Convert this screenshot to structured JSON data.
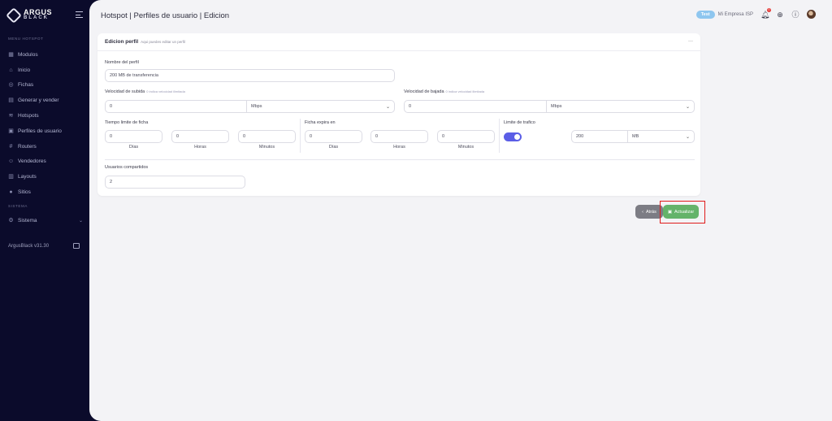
{
  "sidebar": {
    "logo_top": "ARGUS",
    "logo_bottom": "BLACK",
    "section_hotspot": "MENU HOTSPOT",
    "items": [
      {
        "label": "Modulos",
        "icon": "grid-icon"
      },
      {
        "label": "Inicio",
        "icon": "home-icon"
      },
      {
        "label": "Fichas",
        "icon": "ticket-icon"
      },
      {
        "label": "Generar y vender",
        "icon": "apps-icon"
      },
      {
        "label": "Hotspots",
        "icon": "wifi-icon"
      },
      {
        "label": "Perfiles de usuario",
        "icon": "profile-icon"
      },
      {
        "label": "Routers",
        "icon": "router-icon"
      },
      {
        "label": "Vendedores",
        "icon": "users-icon"
      },
      {
        "label": "Layouts",
        "icon": "layout-icon"
      },
      {
        "label": "Sitios",
        "icon": "location-icon"
      }
    ],
    "section_system": "SISTEMA",
    "system_item": {
      "label": "Sistema",
      "icon": "gear-icon"
    },
    "version": "ArgusBlack v31.30"
  },
  "header": {
    "title": "Hotspot | Perfiles de usuario | Edicion",
    "badge": "Test",
    "company": "Mi Empresa ISP",
    "notification_count": "0"
  },
  "card": {
    "title": "Edicion perfil",
    "subtitle": "Aqui puedes editar un perfil",
    "menu": "···"
  },
  "form": {
    "profile_name_label": "Nombre del perfil",
    "profile_name_value": "200 MB de transferencia",
    "upload_label": "Velocidad de subida",
    "upload_hint": "0 indica velocidad ilimitada",
    "upload_value": "0",
    "upload_unit": "Mbps",
    "download_label": "Velocidad de bajada",
    "download_hint": "0 indica velocidad ilimitada",
    "download_value": "0",
    "download_unit": "Mbps",
    "time_limit_label": "Tiempo limite de ficha",
    "time_limit": {
      "days": "0",
      "hours": "0",
      "minutes": "0"
    },
    "expire_label": "Ficha expira en",
    "expire": {
      "days": "0",
      "hours": "0",
      "minutes": "0"
    },
    "unit_days": "Días",
    "unit_hours": "Horas",
    "unit_minutes": "Minutos",
    "traffic_label": "Limite de trafico",
    "traffic_enabled": true,
    "traffic_value": "200",
    "traffic_unit": "MB",
    "shared_label": "Usuarios compartidos",
    "shared_value": "2"
  },
  "actions": {
    "back_label": "Atrás",
    "update_label": "Actualizar"
  },
  "colors": {
    "sidebar_bg": "#0b0b2b",
    "toggle_on": "#5b5ee6",
    "update_button": "#64b36a",
    "back_button": "#7c7c84",
    "highlight": "#e01b1b",
    "badge": "#8ec6ef"
  }
}
